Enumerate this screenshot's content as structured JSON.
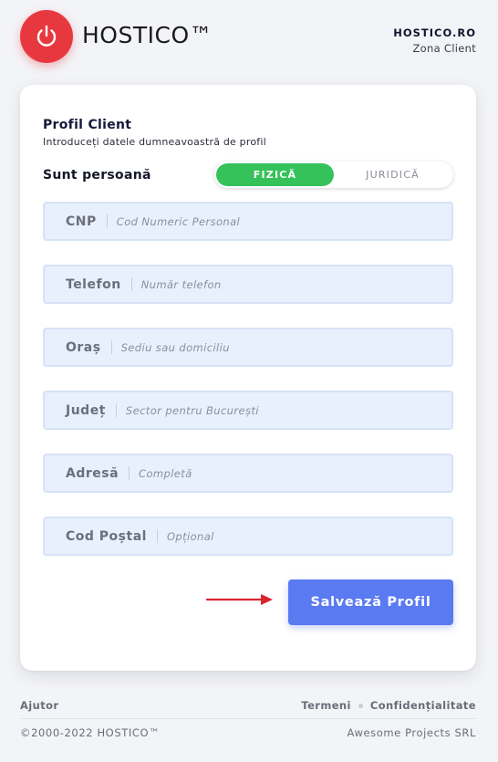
{
  "header": {
    "brand": "HOSTICO™",
    "site_link": "HOSTICO.RO",
    "zone": "Zona Client",
    "logo_color": "#e8383f"
  },
  "card": {
    "title": "Profil Client",
    "subtitle": "Introduceți datele dumneavoastră de profil",
    "person_type_label": "Sunt persoană",
    "toggle": {
      "options": [
        "FIZICĂ",
        "JURIDICĂ"
      ],
      "selected": "FIZICĂ"
    },
    "fields": [
      {
        "label": "CNP",
        "placeholder": "Cod Numeric Personal"
      },
      {
        "label": "Telefon",
        "placeholder": "Număr telefon"
      },
      {
        "label": "Oraș",
        "placeholder": "Sediu sau domiciliu"
      },
      {
        "label": "Județ",
        "placeholder": "Sector pentru București"
      },
      {
        "label": "Adresă",
        "placeholder": "Completă"
      },
      {
        "label": "Cod Poștal",
        "placeholder": "Opțional"
      }
    ],
    "save_label": "Salvează Profil"
  },
  "footer": {
    "help": "Ajutor",
    "terms": "Termeni",
    "privacy": "Confidențialitate",
    "copyright": "©2000-2022 HOSTICO™",
    "company": "Awesome Projects SRL"
  },
  "colors": {
    "accent_green": "#36c25a",
    "button_blue": "#5a7af2",
    "arrow_red": "#d9252f",
    "field_bg": "#e8f0fd"
  },
  "icons": {
    "logo": "power-icon",
    "arrow": "arrow-right-icon"
  }
}
